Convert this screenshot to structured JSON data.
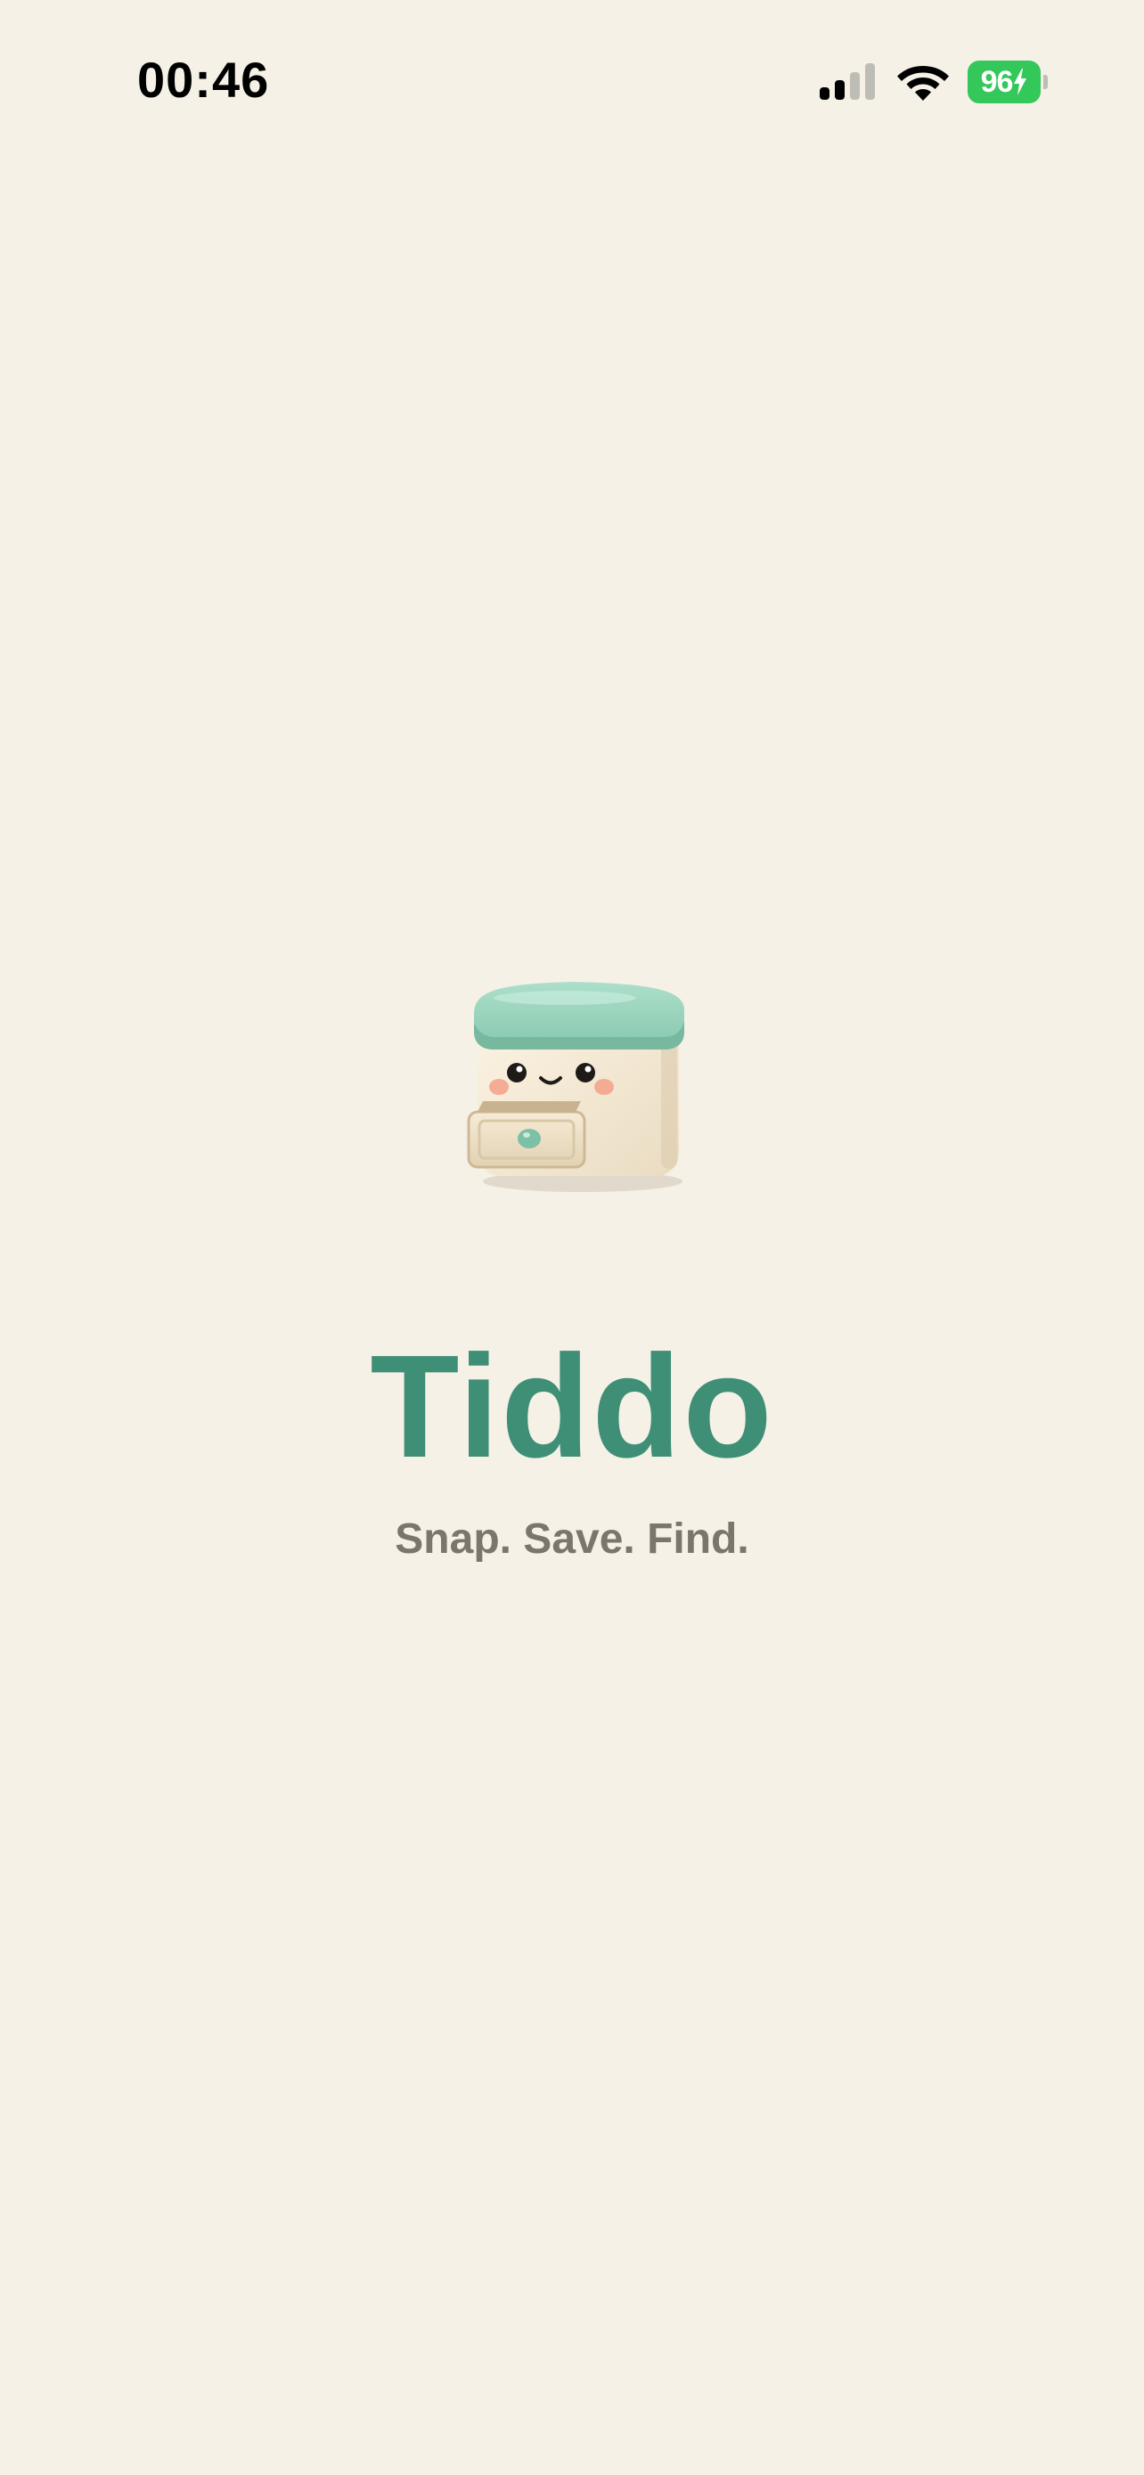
{
  "status_bar": {
    "time": "00:46",
    "battery_level": "96",
    "battery_charging": true,
    "signal_bars_active": 2,
    "signal_bars_total": 4
  },
  "splash": {
    "title": "Tiddo",
    "tagline": "Snap. Save. Find.",
    "mascot_icon": "smiling-drawer-cabinet-icon"
  },
  "colors": {
    "background": "#F5F1E7",
    "brand_green": "#3F8F77",
    "tagline_gray": "#7C756C",
    "battery_green": "#34C759",
    "mascot_lid_mint": "#9ED6C1"
  }
}
